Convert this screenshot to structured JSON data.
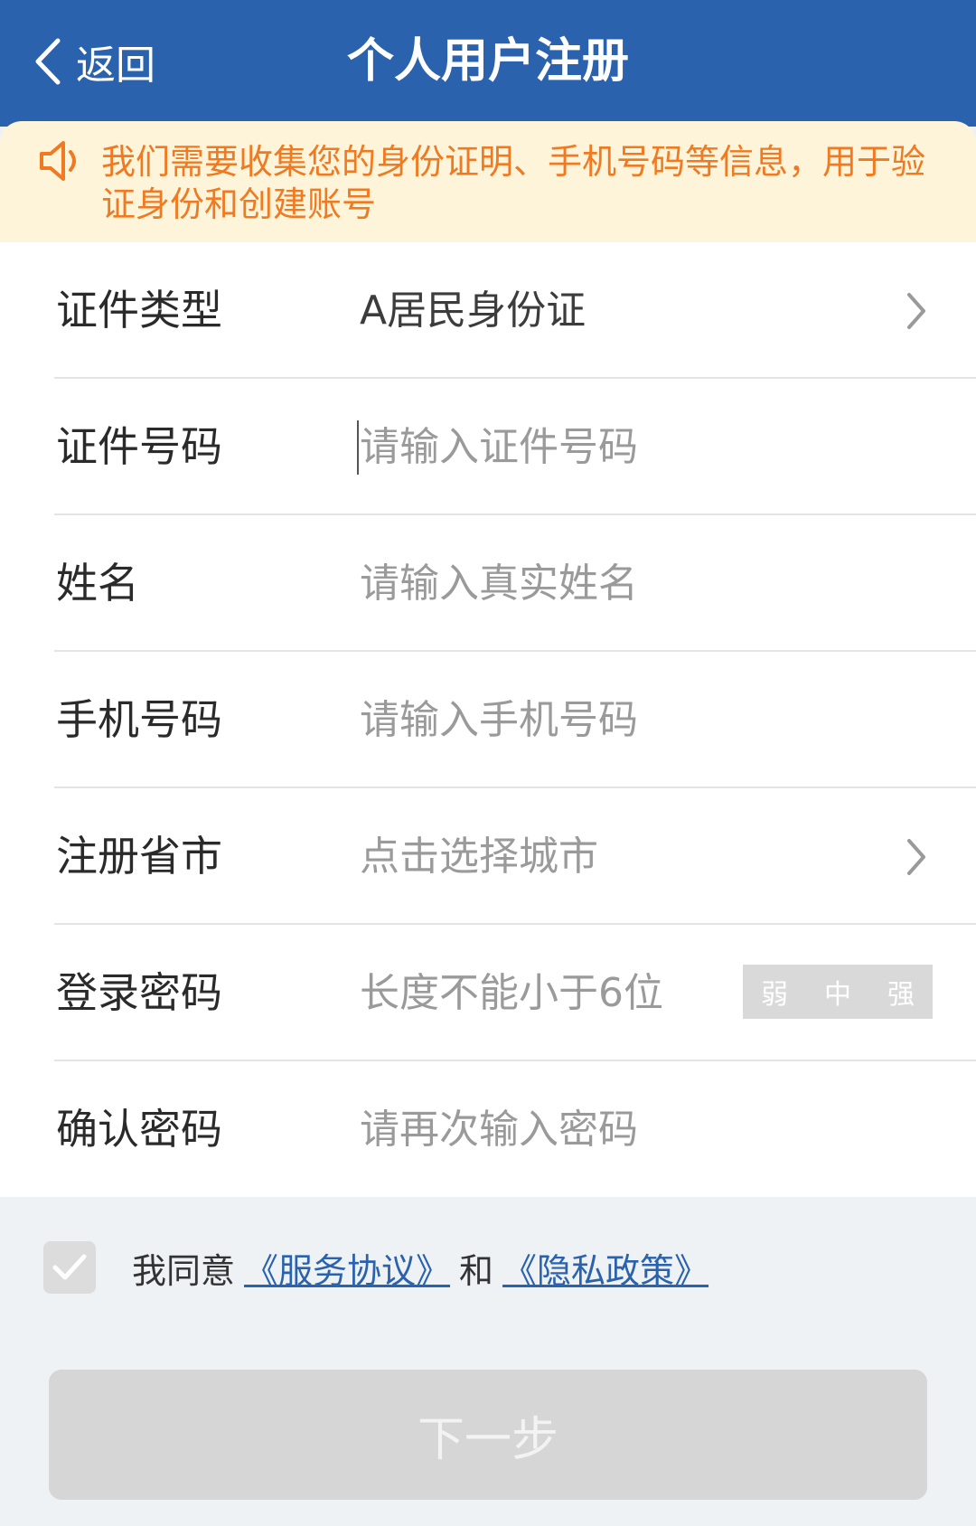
{
  "header": {
    "back_label": "返回",
    "title": "个人用户注册",
    "bg_color": "#2b62ad"
  },
  "notice": {
    "text": "我们需要收集您的身份证明、手机号码等信息，用于验证身份和创建账号",
    "icon": "speaker-icon",
    "color": "#f07a22",
    "bg_color": "#fdf4d9"
  },
  "form": {
    "id_type": {
      "label": "证件类型",
      "value": "A居民身份证"
    },
    "id_number": {
      "label": "证件号码",
      "placeholder": "请输入证件号码"
    },
    "name": {
      "label": "姓名",
      "placeholder": "请输入真实姓名"
    },
    "phone": {
      "label": "手机号码",
      "placeholder": "请输入手机号码"
    },
    "region": {
      "label": "注册省市",
      "placeholder": "点击选择城市"
    },
    "password": {
      "label": "登录密码",
      "placeholder": "长度不能小于6位",
      "strength": [
        "弱",
        "中",
        "强"
      ]
    },
    "confirm": {
      "label": "确认密码",
      "placeholder": "请再次输入密码"
    }
  },
  "agreement": {
    "prefix": "我同意",
    "service_link": "《服务协议》",
    "conj": "和",
    "privacy_link": "《隐私政策》"
  },
  "next_button": "下一步"
}
